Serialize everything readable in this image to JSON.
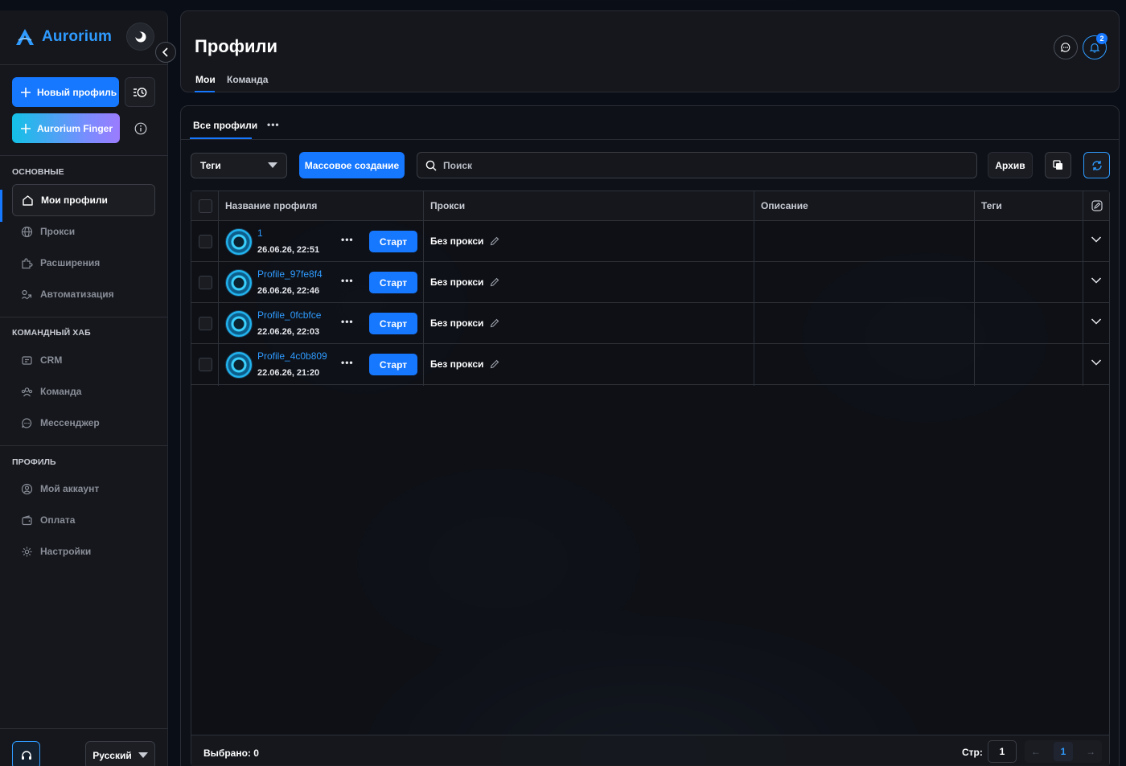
{
  "brand": {
    "name": "Aurorium"
  },
  "sidebar": {
    "new_profile_label": "Новый профиль",
    "finger_label": "Aurorium Finger",
    "sections": [
      {
        "title": "ОСНОВНЫЕ",
        "items": [
          {
            "label": "Мои профили",
            "icon": "home-icon",
            "active": true
          },
          {
            "label": "Прокси",
            "icon": "globe-icon"
          },
          {
            "label": "Расширения",
            "icon": "puzzle-icon"
          },
          {
            "label": "Автоматизация",
            "icon": "robot-icon"
          }
        ]
      },
      {
        "title": "КОМАНДНЫЙ ХАБ",
        "items": [
          {
            "label": "CRM",
            "icon": "crm-icon"
          },
          {
            "label": "Команда",
            "icon": "team-icon"
          },
          {
            "label": "Мессенджер",
            "icon": "chat-icon"
          }
        ]
      },
      {
        "title": "ПРОФИЛЬ",
        "items": [
          {
            "label": "Мой аккаунт",
            "icon": "user-icon"
          },
          {
            "label": "Оплата",
            "icon": "wallet-icon"
          },
          {
            "label": "Настройки",
            "icon": "gear-icon"
          }
        ]
      }
    ],
    "language": "Русский"
  },
  "header": {
    "title": "Профили",
    "tabs": [
      {
        "label": "Мои",
        "active": true
      },
      {
        "label": "Команда",
        "active": false
      }
    ],
    "notification_count": "2"
  },
  "panel": {
    "tab": "Все профили",
    "tags_label": "Теги",
    "mass_create_label": "Массовое создание",
    "search_placeholder": "Поиск",
    "archive_label": "Архив"
  },
  "table": {
    "columns": [
      "Название профиля",
      "Прокси",
      "Описание",
      "Теги"
    ],
    "start_label": "Старт",
    "rows": [
      {
        "name": "1",
        "date": "26.06.26, 22:51",
        "proxy": "Без прокси",
        "description": "",
        "tags": ""
      },
      {
        "name": "Profile_97fe8f4",
        "date": "26.06.26, 22:46",
        "proxy": "Без прокси",
        "description": "",
        "tags": ""
      },
      {
        "name": "Profile_0fcbfce",
        "date": "22.06.26, 22:03",
        "proxy": "Без прокси",
        "description": "",
        "tags": ""
      },
      {
        "name": "Profile_4c0b809",
        "date": "22.06.26, 21:20",
        "proxy": "Без прокси",
        "description": "",
        "tags": ""
      }
    ],
    "footer": {
      "selected": "Выбрано: 0",
      "page_label": "Стр:",
      "page_value": "1",
      "current_page": "1"
    }
  },
  "colors": {
    "accent": "#1677ff",
    "link": "#2f9bff",
    "bg": "#0a0e16",
    "panel": "#15171c"
  }
}
